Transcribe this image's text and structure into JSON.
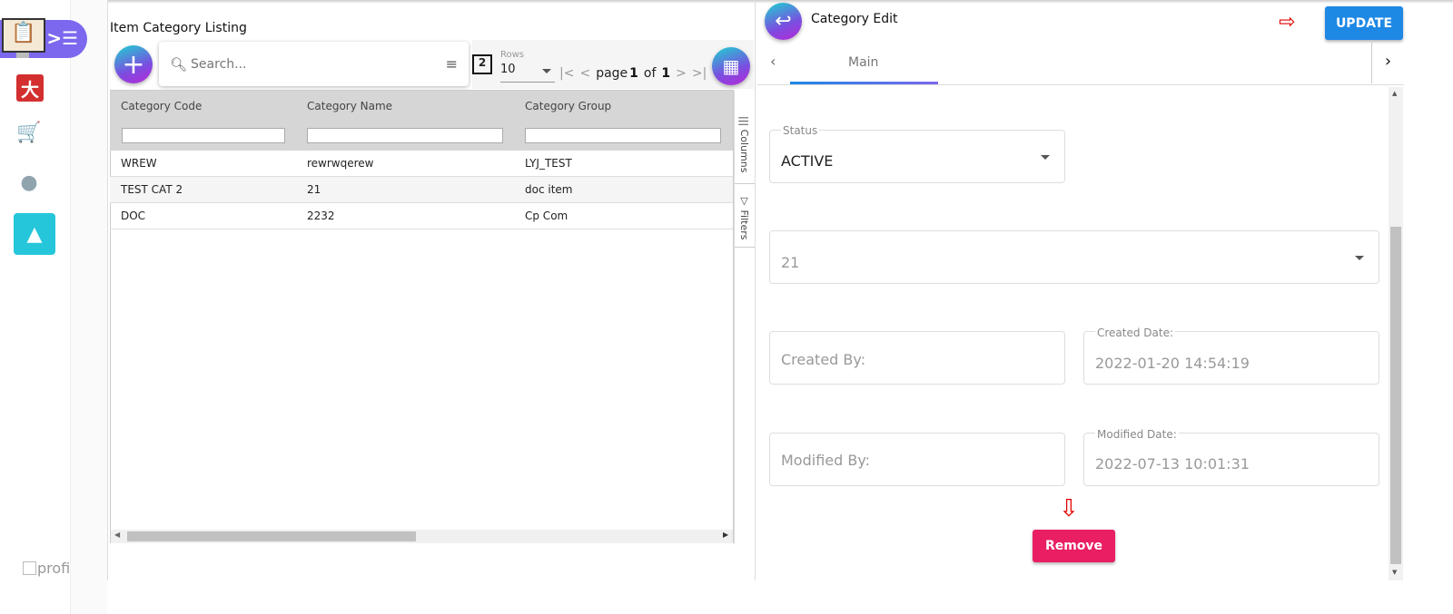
{
  "sidebar": {
    "profile_label": "profi"
  },
  "listing": {
    "title": "Item Category Listing",
    "search_placeholder": "Search...",
    "rows_label": "Rows",
    "rows_value": "10",
    "page_word": "page",
    "page_current": "1",
    "of_word": "of",
    "page_total": "1",
    "columns": [
      "Category Code",
      "Category Name",
      "Category Group"
    ],
    "rows": [
      [
        "WREW",
        "rewrwqerew",
        "LYJ_TEST"
      ],
      [
        "TEST CAT 2",
        "21",
        "doc item"
      ],
      [
        "DOC",
        "2232",
        "Cp Com"
      ]
    ],
    "side_tabs": {
      "columns": "Columns",
      "filters": "Filters"
    }
  },
  "edit": {
    "title": "Category Edit",
    "update_label": "UPDATE",
    "tab_main": "Main",
    "status_label": "Status",
    "status_value": "ACTIVE",
    "group_value": "21",
    "created_by_label": "Created By:",
    "created_date_label": "Created Date:",
    "created_date_value": "2022-01-20 14:54:19",
    "modified_by_label": "Modified By:",
    "modified_date_label": "Modified Date:",
    "modified_date_value": "2022-07-13 10:01:31",
    "remove_label": "Remove"
  },
  "colors": {
    "accent": "#7b68ee",
    "update": "#1e88e5",
    "remove": "#e91e63",
    "arrow": "#e00000"
  }
}
